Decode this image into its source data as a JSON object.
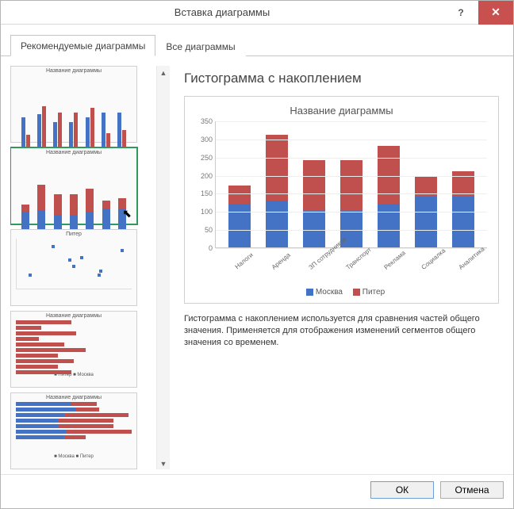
{
  "titlebar": {
    "title": "Вставка диаграммы",
    "help": "?",
    "close": "✕"
  },
  "tabs": {
    "recommended": "Рекомендуемые диаграммы",
    "all": "Все диаграммы"
  },
  "thumbs_common": {
    "title_default": "Название диаграммы",
    "title_scatter": "Питер",
    "legend_cities": "■ Москва  ■ Питер",
    "legend_cities_rev": "■ Питер  ■ Москва"
  },
  "preview": {
    "heading": "Гистограмма с накоплением",
    "chart_title": "Название диаграммы",
    "legend_a": "Москва",
    "legend_b": "Питер",
    "description": "Гистограмма с накоплением используется для сравнения частей общего значения. Применяется для отображения изменений сегментов общего значения со временем."
  },
  "buttons": {
    "ok": "ОК",
    "cancel": "Отмена"
  },
  "scroll": {
    "up": "▲",
    "down": "▼"
  },
  "chart_data": {
    "type": "bar",
    "stacked": true,
    "title": "Название диаграммы",
    "xlabel": "",
    "ylabel": "",
    "ylim": [
      0,
      350
    ],
    "yticks": [
      0,
      50,
      100,
      150,
      200,
      250,
      300,
      350
    ],
    "categories": [
      "Налоги",
      "Аренда",
      "ЗП сотрудников",
      "Транспорт",
      "Реклама",
      "Социалка",
      "Аналитика"
    ],
    "series": [
      {
        "name": "Москва",
        "color": "#4472c4",
        "values": [
          120,
          130,
          100,
          100,
          120,
          140,
          140
        ]
      },
      {
        "name": "Питер",
        "color": "#c0504d",
        "values": [
          50,
          180,
          140,
          140,
          160,
          55,
          70
        ]
      }
    ]
  }
}
